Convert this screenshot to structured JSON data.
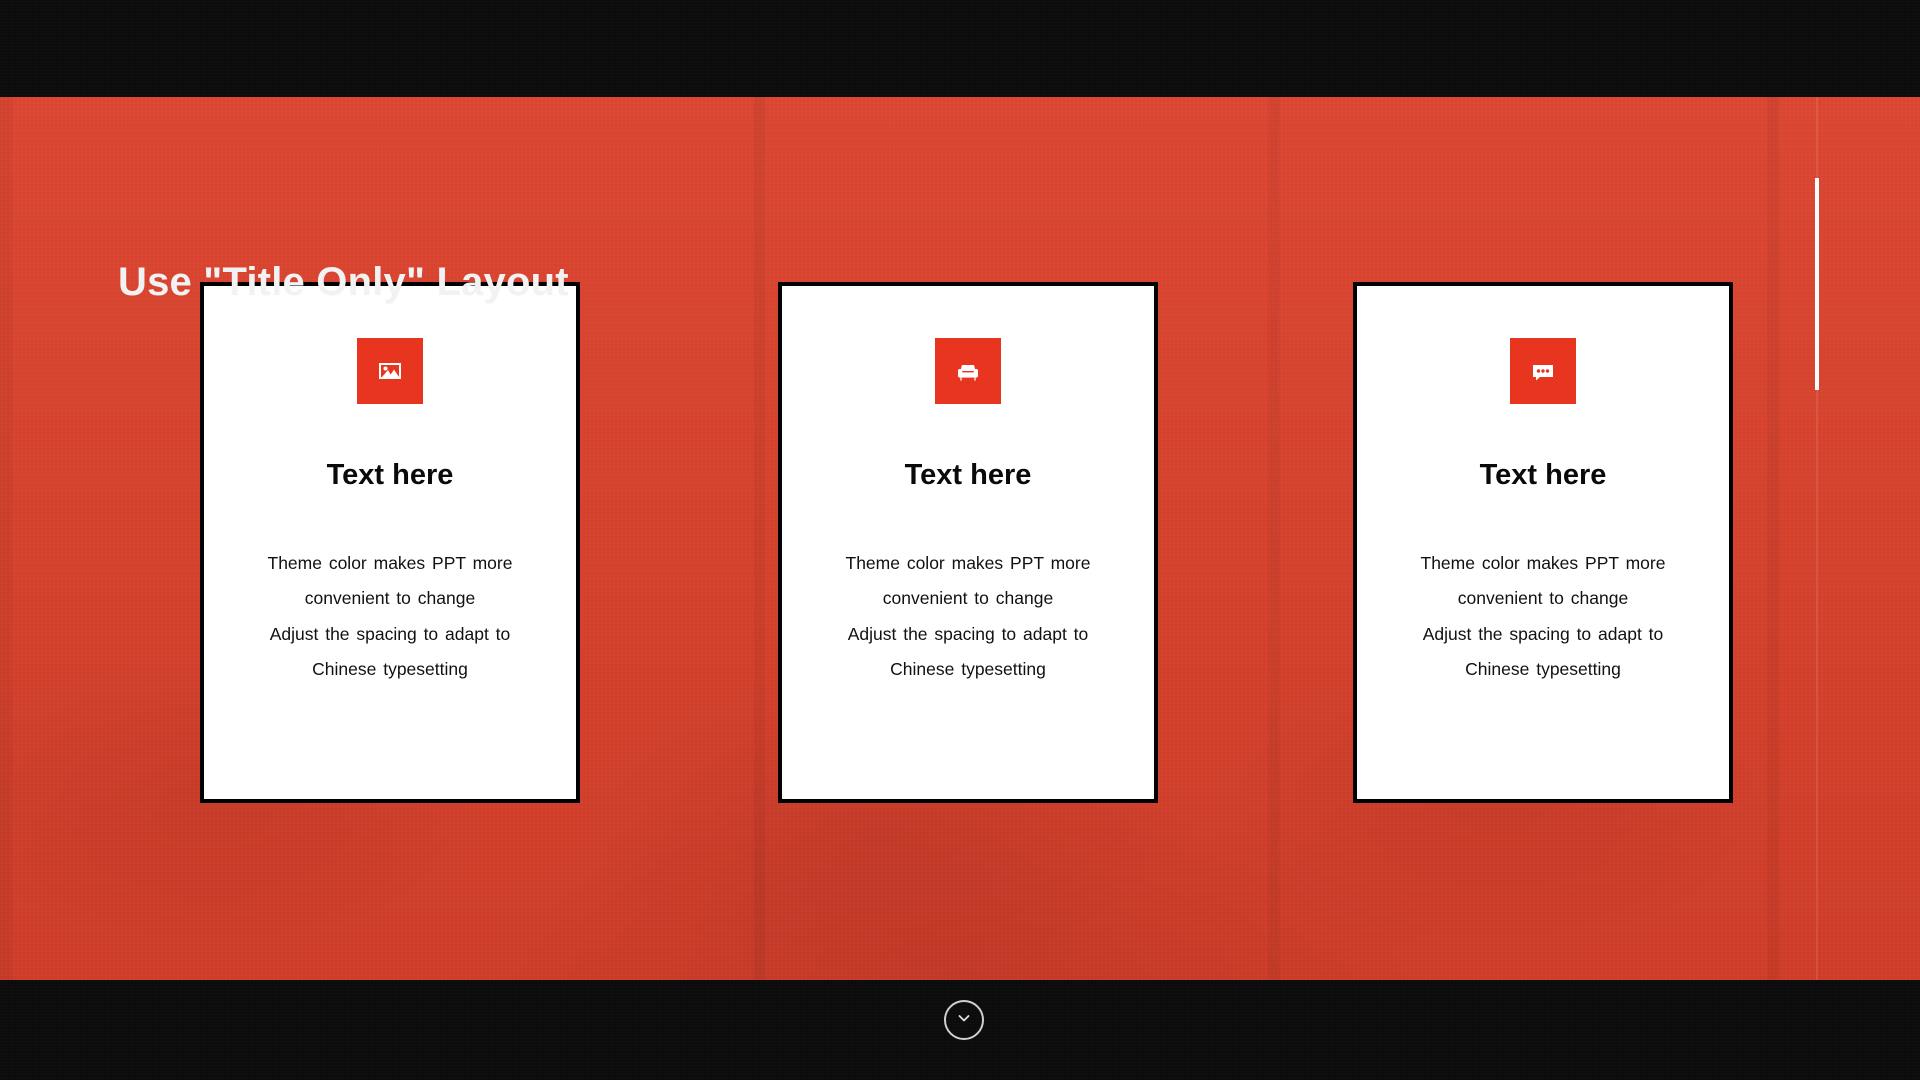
{
  "slide": {
    "title": "Use \"Title Only\" Layout",
    "background_color": "#d9402b",
    "bar_color": "#0b0b0b",
    "accent_color": "#e8351f",
    "card_border_color": "#000000",
    "card_background": "#ffffff",
    "title_color": "#f2f2f2"
  },
  "scrollbar": {
    "thumb_color": "#ffffff",
    "track_color": "rgba(255,255,255,0.10)"
  },
  "footer": {
    "scroll_down_icon": "chevron-down-icon"
  },
  "cards": [
    {
      "icon": "image-icon",
      "title": "Text here",
      "body_lines": [
        "Theme  color makes PPT more",
        "convenient to change",
        "Adjust the spacing to adapt to",
        "Chinese typesetting"
      ]
    },
    {
      "icon": "armchair-icon",
      "title": "Text here",
      "body_lines": [
        "Theme  color makes PPT more",
        "convenient to change",
        "Adjust the spacing to adapt to",
        "Chinese typesetting"
      ]
    },
    {
      "icon": "chat-bubble-icon",
      "title": "Text here",
      "body_lines": [
        "Theme  color makes PPT more",
        "convenient to change",
        "Adjust the spacing to adapt to",
        "Chinese typesetting"
      ]
    }
  ]
}
